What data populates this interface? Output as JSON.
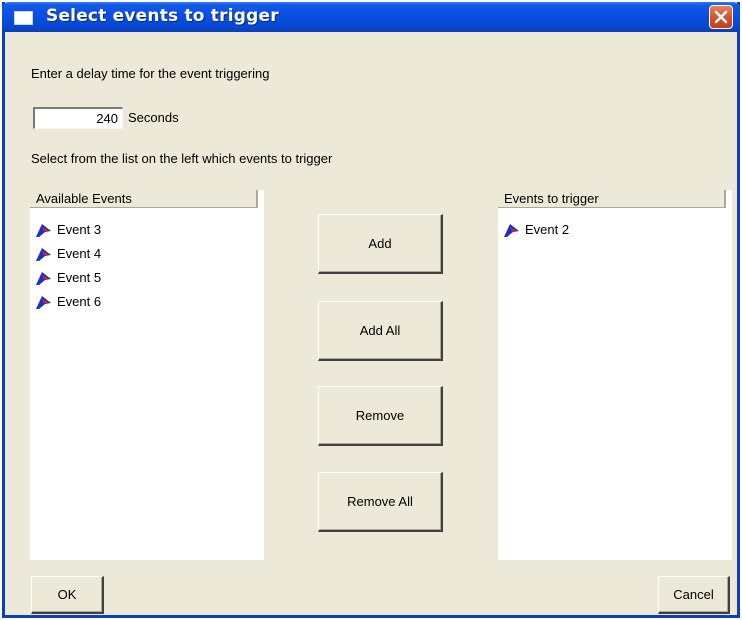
{
  "window": {
    "title": "Select events to trigger"
  },
  "delay": {
    "prompt": "Enter a delay time for the event triggering",
    "value": "240",
    "unit": "Seconds"
  },
  "instructions": "Select from the list on the left which events to trigger",
  "available_list": {
    "header": "Available Events",
    "items": [
      {
        "label": "Event 3",
        "icon": "event-flag-icon"
      },
      {
        "label": "Event 4",
        "icon": "event-flag-icon"
      },
      {
        "label": "Event 5",
        "icon": "event-flag-icon"
      },
      {
        "label": "Event 6",
        "icon": "event-flag-icon"
      }
    ]
  },
  "trigger_list": {
    "header": "Events to trigger",
    "items": [
      {
        "label": "Event 2",
        "icon": "event-flag-icon"
      }
    ]
  },
  "buttons": {
    "add": "Add",
    "add_all": "Add All",
    "remove": "Remove",
    "remove_all": "Remove All",
    "ok": "OK",
    "cancel": "Cancel"
  },
  "colors": {
    "titlebar": "#0a4fe0",
    "dialog_face": "#ece9d8",
    "close_button": "#d4502a",
    "flag_blue": "#1a2fc8",
    "flag_red": "#e01e1e"
  }
}
